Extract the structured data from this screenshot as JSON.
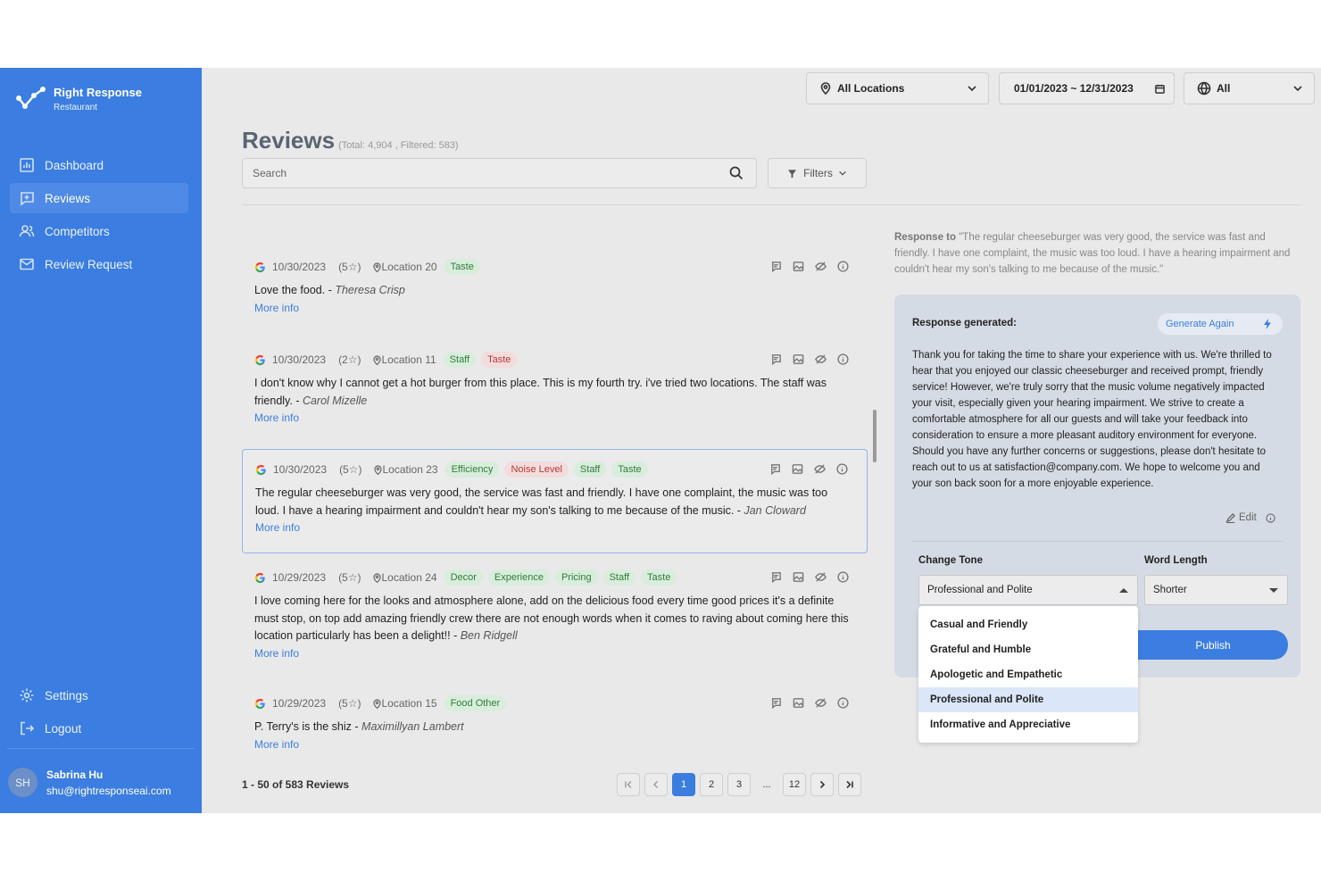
{
  "brand": {
    "name": "Right Response",
    "subtitle": "Restaurant"
  },
  "sidebar": {
    "items": [
      {
        "label": "Dashboard",
        "icon": "bar-chart-icon"
      },
      {
        "label": "Reviews",
        "icon": "review-icon",
        "active": true
      },
      {
        "label": "Competitors",
        "icon": "users-icon"
      },
      {
        "label": "Review Request",
        "icon": "mail-icon"
      }
    ],
    "bottom": [
      {
        "label": "Settings",
        "icon": "gear-icon"
      },
      {
        "label": "Logout",
        "icon": "logout-icon"
      }
    ],
    "user": {
      "initials": "SH",
      "name": "Sabrina Hu",
      "email": "shu@rightresponseai.com"
    }
  },
  "topbar": {
    "location": "All Locations",
    "date_range": "01/01/2023 ~ 12/31/2023",
    "language": "All"
  },
  "header": {
    "title": "Reviews",
    "totals": "(Total: 4,904 , Filtered: 583)",
    "search_placeholder": "Search",
    "filters_label": "Filters"
  },
  "reviews": [
    {
      "date": "10/30/2023",
      "stars": "(5☆)",
      "location": "Location 20",
      "tags": [
        {
          "label": "Taste",
          "color": "green"
        }
      ],
      "text": "Love the food.",
      "author": "Theresa Crisp",
      "more": "More info"
    },
    {
      "date": "10/30/2023",
      "stars": "(2☆)",
      "location": "Location 11",
      "tags": [
        {
          "label": "Staff",
          "color": "green"
        },
        {
          "label": "Taste",
          "color": "red"
        }
      ],
      "text": "I don't know why I cannot get a hot burger from this place. This is my fourth try. i've tried two locations. The staff was friendly.",
      "author": "Carol Mizelle",
      "more": "More info"
    },
    {
      "date": "10/30/2023",
      "stars": "(5☆)",
      "location": "Location 23",
      "tags": [
        {
          "label": "Efficiency",
          "color": "green"
        },
        {
          "label": "Noise Level",
          "color": "red"
        },
        {
          "label": "Staff",
          "color": "green"
        },
        {
          "label": "Taste",
          "color": "green"
        }
      ],
      "text": "The regular cheeseburger was very good, the service was fast and friendly. I have one complaint, the music was too loud. I have a hearing impairment and couldn't hear my son's talking to me because of the music.",
      "author": "Jan Cloward",
      "more": "More info"
    },
    {
      "date": "10/29/2023",
      "stars": "(5☆)",
      "location": "Location 24",
      "tags": [
        {
          "label": "Decor",
          "color": "green"
        },
        {
          "label": "Experience",
          "color": "green"
        },
        {
          "label": "Pricing",
          "color": "green"
        },
        {
          "label": "Staff",
          "color": "green"
        },
        {
          "label": "Taste",
          "color": "green"
        }
      ],
      "text": "I love coming here for the looks and atmosphere alone, add on the delicious food every time good prices it's a definite must stop, on top add amazing friendly crew there are not enough words when it comes to raving about coming here this location particularly has been a delight!!",
      "author": "Ben Ridgell",
      "more": "More info"
    },
    {
      "date": "10/29/2023",
      "stars": "(5☆)",
      "location": "Location 15",
      "tags": [
        {
          "label": "Food Other",
          "color": "green"
        }
      ],
      "text": "P. Terry's is the shiz",
      "author": "Maximillyan Lambert",
      "more": "More info"
    }
  ],
  "pagination": {
    "summary": "1 - 50 of 583 Reviews",
    "pages": [
      "1",
      "2",
      "3",
      "...",
      "12"
    ],
    "current": "1"
  },
  "response": {
    "to_label": "Response to",
    "to_text": "\"The regular cheeseburger was very good, the service was fast and friendly. I have one complaint, the music was too loud. I have a hearing impairment and couldn't hear my son's talking to me because of the music.\"",
    "generated_label": "Response generated:",
    "generate_again": "Generate Again",
    "text": "Thank you for taking the time to share your experience with us. We're thrilled to hear that you enjoyed our classic cheeseburger and received prompt, friendly service! However, we're truly sorry that the music volume negatively impacted your visit, especially given your hearing impairment. We strive to create a comfortable atmosphere for all our guests and will take your feedback into consideration to ensure a more pleasant auditory environment for everyone. Should you have any further concerns or suggestions, please don't hesitate to reach out to us at satisfaction@company.com. We hope to welcome you and your son back soon for a more enjoyable experience.",
    "edit_label": "Edit",
    "tone_label": "Change Tone",
    "tone_value": "Professional and Polite",
    "length_label": "Word Length",
    "length_value": "Shorter",
    "publish_label": "Publish",
    "tone_options": [
      "Casual and Friendly",
      "Grateful and Humble",
      "Apologetic and Empathetic",
      "Professional and Polite",
      "Informative and Appreciative"
    ]
  },
  "colors": {
    "accent": "#3b7de0",
    "sidebar": "#3b7de0",
    "tag_green": "#2f7d3c",
    "tag_red": "#b53a3a"
  }
}
